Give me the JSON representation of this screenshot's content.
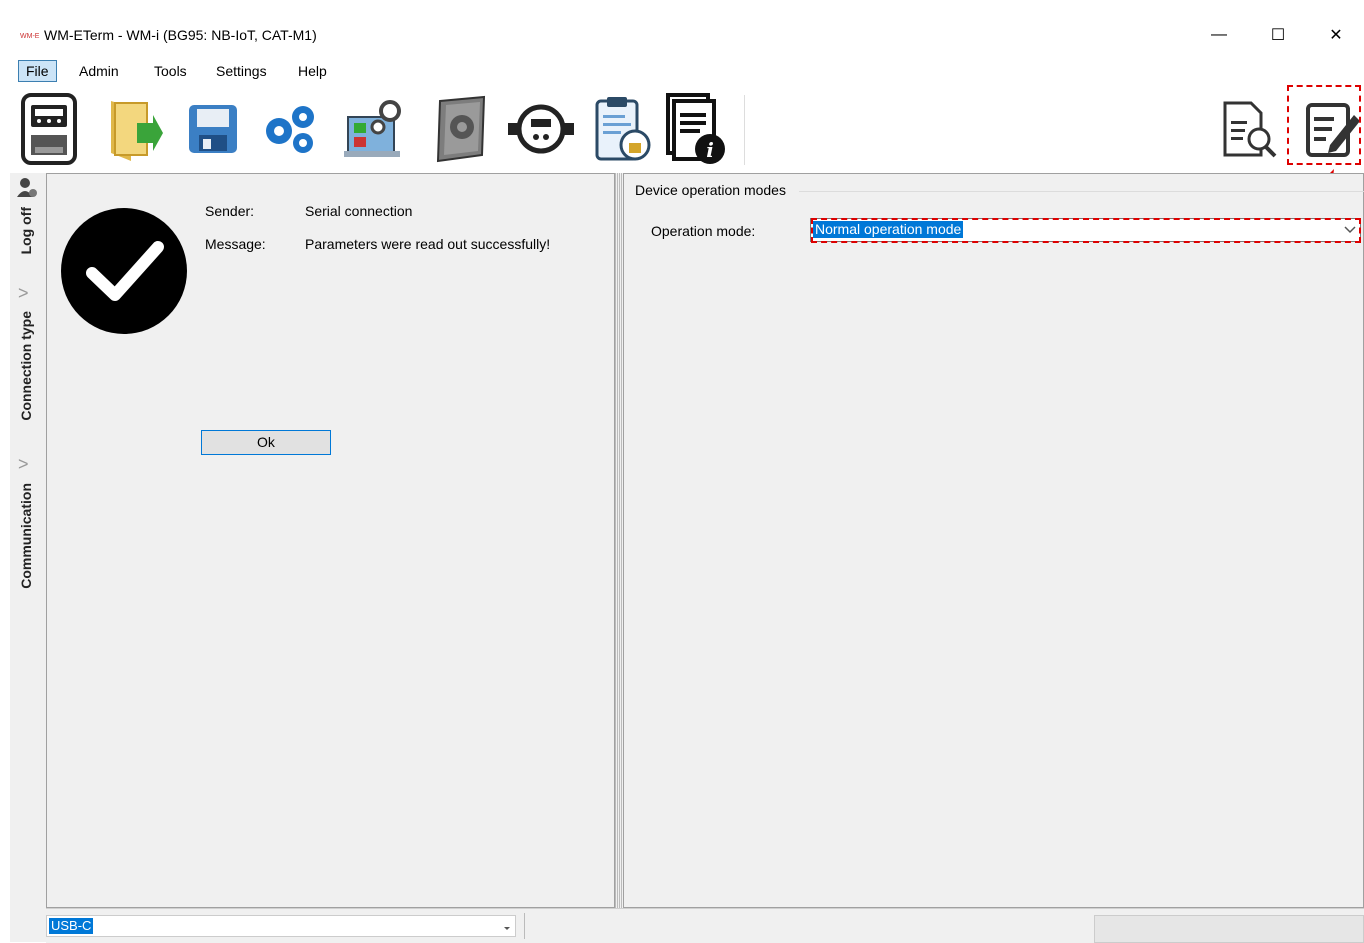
{
  "window": {
    "title": "WM-ETerm - WM-i (BG95: NB-IoT, CAT-M1)",
    "logo_text": "WM-E",
    "minimize_glyph": "—",
    "maximize_glyph": "☐",
    "close_glyph": "✕"
  },
  "menubar": {
    "items": [
      {
        "label": "File"
      },
      {
        "label": "Admin"
      },
      {
        "label": "Tools"
      },
      {
        "label": "Settings"
      },
      {
        "label": "Help"
      }
    ]
  },
  "toolbar": {
    "icons": [
      "meter-icon",
      "open-folder-icon",
      "save-icon",
      "gears-icon",
      "parameter-checklist-icon",
      "firmware-book-icon",
      "water-meter-icon",
      "locked-clipboard-icon",
      "document-info-icon",
      "document-search-icon",
      "edit-document-icon"
    ]
  },
  "sidebar": {
    "user_icon": "user-icon",
    "tabs": [
      {
        "label": "Log off"
      },
      {
        "label": "Connection type"
      },
      {
        "label": "Communication"
      }
    ]
  },
  "message_panel": {
    "sender_label": "Sender:",
    "sender_value": "Serial connection",
    "message_label": "Message:",
    "message_value": "Parameters were read out successfully!",
    "ok_label": "Ok",
    "status_icon": "success-check-icon"
  },
  "operation_panel": {
    "group_title": "Device operation modes",
    "operation_mode_label": "Operation mode:",
    "operation_mode_value": "Normal operation mode"
  },
  "statusbar": {
    "port_value": "USB-C"
  },
  "colors": {
    "selection": "#0078d7",
    "annotation": "#dd0000",
    "panel_bg": "#f0f0f0"
  }
}
